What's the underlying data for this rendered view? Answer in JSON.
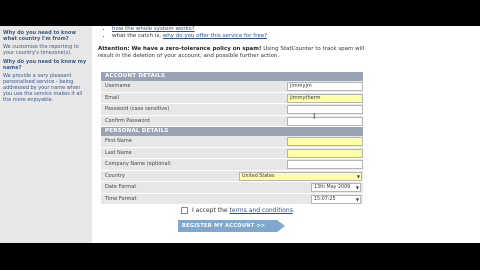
{
  "sidebar": {
    "q1": "Why do you need to know what country I'm from?",
    "a1": "We customise the reporting to your country's timezone(s).",
    "q2": "Why do you need to know my name?",
    "a2": "We provide a very pleasant personalised service - being addressed by your name when you use the service makes it all the more enjoyable."
  },
  "links": {
    "how_works": "how the whole system works?",
    "catch_prefix": "what the catch is, ",
    "catch_link": "why do you offer this service for free?"
  },
  "warning": {
    "bold": "Attention: We have a zero-tolerance policy on spam!",
    "text": " Using StatCounter to track spam will result in the deletion of your account, and possible further action."
  },
  "account": {
    "title": "ACCOUNT DETAILS",
    "username_label": "Username",
    "username_value": "jimmyjm",
    "email_label": "Email",
    "email_value": "jimmytherm",
    "password_label": "Password (case sensitive)",
    "confirm_label": "Confirm Password"
  },
  "personal": {
    "title": "PERSONAL DETAILS",
    "first_label": "First Name",
    "last_label": "Last Name",
    "company_label": "Company Name (optional)",
    "country_label": "Country",
    "country_value": "United States",
    "date_label": "Date Format",
    "date_value": "13th May 2009",
    "time_label": "Time Format",
    "time_value": "15:07:25"
  },
  "agree": {
    "prefix": "I accept the ",
    "link": "terms and conditions",
    "suffix": "."
  },
  "register_label": "REGISTER MY ACCOUNT >>"
}
